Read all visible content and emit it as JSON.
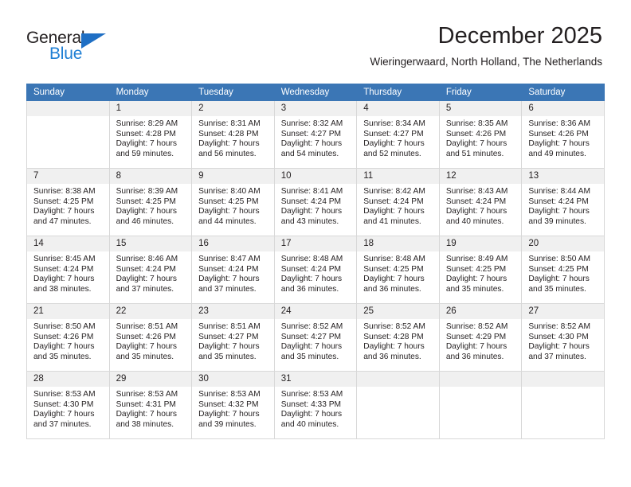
{
  "brand": {
    "name_top": "General",
    "name_bottom": "Blue",
    "accent_color": "#1f7fd4",
    "triangle_color": "#1f6fc4"
  },
  "header": {
    "title": "December 2025",
    "subtitle": "Wieringerwaard, North Holland, The Netherlands"
  },
  "calendar": {
    "header_bg": "#3b76b5",
    "daynum_bg": "#f0f0f0",
    "weekday_headers": [
      "Sunday",
      "Monday",
      "Tuesday",
      "Wednesday",
      "Thursday",
      "Friday",
      "Saturday"
    ],
    "weeks": [
      [
        {
          "day": "",
          "lines": []
        },
        {
          "day": "1",
          "lines": [
            "Sunrise: 8:29 AM",
            "Sunset: 4:28 PM",
            "Daylight: 7 hours",
            "and 59 minutes."
          ]
        },
        {
          "day": "2",
          "lines": [
            "Sunrise: 8:31 AM",
            "Sunset: 4:28 PM",
            "Daylight: 7 hours",
            "and 56 minutes."
          ]
        },
        {
          "day": "3",
          "lines": [
            "Sunrise: 8:32 AM",
            "Sunset: 4:27 PM",
            "Daylight: 7 hours",
            "and 54 minutes."
          ]
        },
        {
          "day": "4",
          "lines": [
            "Sunrise: 8:34 AM",
            "Sunset: 4:27 PM",
            "Daylight: 7 hours",
            "and 52 minutes."
          ]
        },
        {
          "day": "5",
          "lines": [
            "Sunrise: 8:35 AM",
            "Sunset: 4:26 PM",
            "Daylight: 7 hours",
            "and 51 minutes."
          ]
        },
        {
          "day": "6",
          "lines": [
            "Sunrise: 8:36 AM",
            "Sunset: 4:26 PM",
            "Daylight: 7 hours",
            "and 49 minutes."
          ]
        }
      ],
      [
        {
          "day": "7",
          "lines": [
            "Sunrise: 8:38 AM",
            "Sunset: 4:25 PM",
            "Daylight: 7 hours",
            "and 47 minutes."
          ]
        },
        {
          "day": "8",
          "lines": [
            "Sunrise: 8:39 AM",
            "Sunset: 4:25 PM",
            "Daylight: 7 hours",
            "and 46 minutes."
          ]
        },
        {
          "day": "9",
          "lines": [
            "Sunrise: 8:40 AM",
            "Sunset: 4:25 PM",
            "Daylight: 7 hours",
            "and 44 minutes."
          ]
        },
        {
          "day": "10",
          "lines": [
            "Sunrise: 8:41 AM",
            "Sunset: 4:24 PM",
            "Daylight: 7 hours",
            "and 43 minutes."
          ]
        },
        {
          "day": "11",
          "lines": [
            "Sunrise: 8:42 AM",
            "Sunset: 4:24 PM",
            "Daylight: 7 hours",
            "and 41 minutes."
          ]
        },
        {
          "day": "12",
          "lines": [
            "Sunrise: 8:43 AM",
            "Sunset: 4:24 PM",
            "Daylight: 7 hours",
            "and 40 minutes."
          ]
        },
        {
          "day": "13",
          "lines": [
            "Sunrise: 8:44 AM",
            "Sunset: 4:24 PM",
            "Daylight: 7 hours",
            "and 39 minutes."
          ]
        }
      ],
      [
        {
          "day": "14",
          "lines": [
            "Sunrise: 8:45 AM",
            "Sunset: 4:24 PM",
            "Daylight: 7 hours",
            "and 38 minutes."
          ]
        },
        {
          "day": "15",
          "lines": [
            "Sunrise: 8:46 AM",
            "Sunset: 4:24 PM",
            "Daylight: 7 hours",
            "and 37 minutes."
          ]
        },
        {
          "day": "16",
          "lines": [
            "Sunrise: 8:47 AM",
            "Sunset: 4:24 PM",
            "Daylight: 7 hours",
            "and 37 minutes."
          ]
        },
        {
          "day": "17",
          "lines": [
            "Sunrise: 8:48 AM",
            "Sunset: 4:24 PM",
            "Daylight: 7 hours",
            "and 36 minutes."
          ]
        },
        {
          "day": "18",
          "lines": [
            "Sunrise: 8:48 AM",
            "Sunset: 4:25 PM",
            "Daylight: 7 hours",
            "and 36 minutes."
          ]
        },
        {
          "day": "19",
          "lines": [
            "Sunrise: 8:49 AM",
            "Sunset: 4:25 PM",
            "Daylight: 7 hours",
            "and 35 minutes."
          ]
        },
        {
          "day": "20",
          "lines": [
            "Sunrise: 8:50 AM",
            "Sunset: 4:25 PM",
            "Daylight: 7 hours",
            "and 35 minutes."
          ]
        }
      ],
      [
        {
          "day": "21",
          "lines": [
            "Sunrise: 8:50 AM",
            "Sunset: 4:26 PM",
            "Daylight: 7 hours",
            "and 35 minutes."
          ]
        },
        {
          "day": "22",
          "lines": [
            "Sunrise: 8:51 AM",
            "Sunset: 4:26 PM",
            "Daylight: 7 hours",
            "and 35 minutes."
          ]
        },
        {
          "day": "23",
          "lines": [
            "Sunrise: 8:51 AM",
            "Sunset: 4:27 PM",
            "Daylight: 7 hours",
            "and 35 minutes."
          ]
        },
        {
          "day": "24",
          "lines": [
            "Sunrise: 8:52 AM",
            "Sunset: 4:27 PM",
            "Daylight: 7 hours",
            "and 35 minutes."
          ]
        },
        {
          "day": "25",
          "lines": [
            "Sunrise: 8:52 AM",
            "Sunset: 4:28 PM",
            "Daylight: 7 hours",
            "and 36 minutes."
          ]
        },
        {
          "day": "26",
          "lines": [
            "Sunrise: 8:52 AM",
            "Sunset: 4:29 PM",
            "Daylight: 7 hours",
            "and 36 minutes."
          ]
        },
        {
          "day": "27",
          "lines": [
            "Sunrise: 8:52 AM",
            "Sunset: 4:30 PM",
            "Daylight: 7 hours",
            "and 37 minutes."
          ]
        }
      ],
      [
        {
          "day": "28",
          "lines": [
            "Sunrise: 8:53 AM",
            "Sunset: 4:30 PM",
            "Daylight: 7 hours",
            "and 37 minutes."
          ]
        },
        {
          "day": "29",
          "lines": [
            "Sunrise: 8:53 AM",
            "Sunset: 4:31 PM",
            "Daylight: 7 hours",
            "and 38 minutes."
          ]
        },
        {
          "day": "30",
          "lines": [
            "Sunrise: 8:53 AM",
            "Sunset: 4:32 PM",
            "Daylight: 7 hours",
            "and 39 minutes."
          ]
        },
        {
          "day": "31",
          "lines": [
            "Sunrise: 8:53 AM",
            "Sunset: 4:33 PM",
            "Daylight: 7 hours",
            "and 40 minutes."
          ]
        },
        {
          "day": "",
          "lines": []
        },
        {
          "day": "",
          "lines": []
        },
        {
          "day": "",
          "lines": []
        }
      ]
    ]
  }
}
